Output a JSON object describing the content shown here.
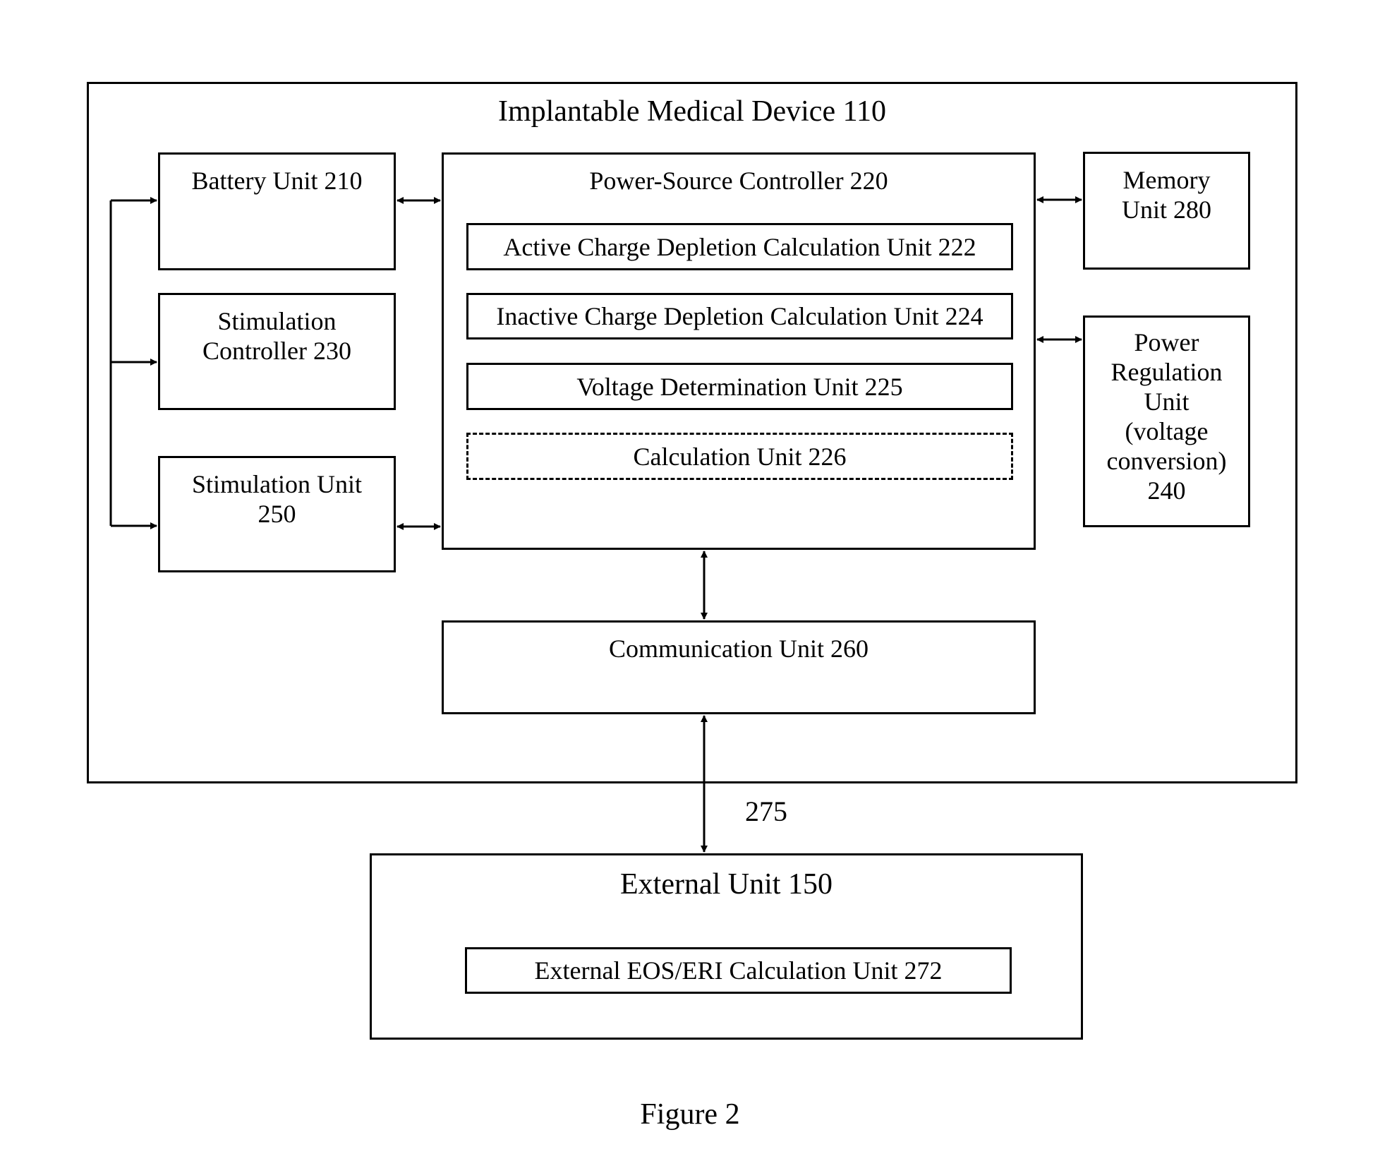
{
  "device": {
    "title": "Implantable Medical Device 110",
    "battery": "Battery Unit 210",
    "stim_controller": [
      "Stimulation",
      "Controller 230"
    ],
    "stim_unit": [
      "Stimulation Unit",
      "250"
    ],
    "power_controller": {
      "title": "Power-Source Controller 220",
      "sub_units": [
        {
          "label": "Active Charge Depletion Calculation Unit 222",
          "style": "solid"
        },
        {
          "label": "Inactive Charge Depletion Calculation Unit 224",
          "style": "solid"
        },
        {
          "label": "Voltage Determination Unit 225",
          "style": "solid"
        },
        {
          "label": "Calculation Unit 226",
          "style": "dashed"
        }
      ]
    },
    "memory": [
      "Memory",
      "Unit 280"
    ],
    "power_regulation": [
      "Power",
      "Regulation",
      "Unit",
      "(voltage",
      "conversion)",
      "240"
    ],
    "communication": "Communication Unit 260"
  },
  "link_label": "275",
  "external": {
    "title": "External Unit 150",
    "sub_unit": "External EOS/ERI Calculation Unit 272"
  },
  "caption": "Figure 2"
}
